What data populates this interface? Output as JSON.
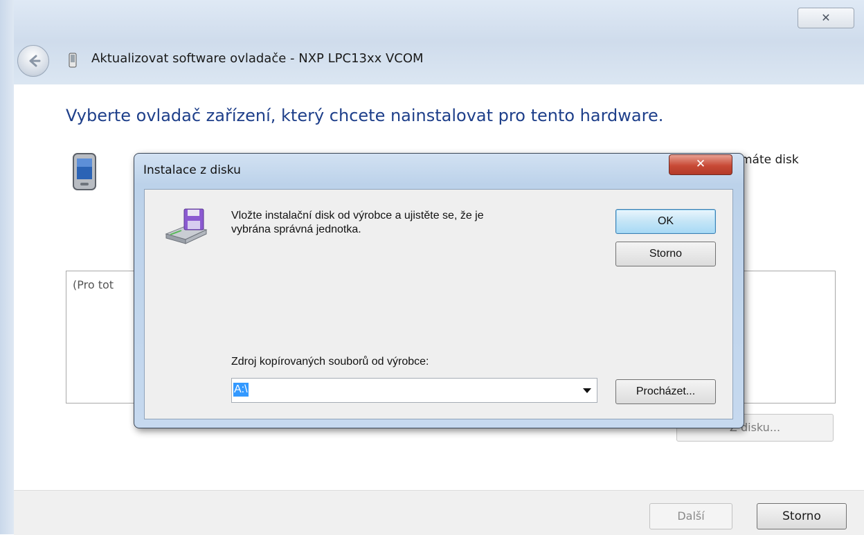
{
  "window": {
    "title": "Aktualizovat software ovladače - NXP LPC13xx VCOM",
    "close_glyph": "✕"
  },
  "wizard": {
    "heading": "Vyberte ovladač zařízení, který chcete nainstalovat pro tento hardware.",
    "description_visible": "máte disk",
    "list_text": "(Pro tot",
    "have_disk_button": "Z disku...",
    "next_button": "Další",
    "cancel_button": "Storno"
  },
  "dialog": {
    "title": "Instalace z disku",
    "close_glyph": "✕",
    "message_line1": "Vložte instalační disk od výrobce a ujistěte se, že je",
    "message_line2": "vybrána správná jednotka.",
    "ok_button": "OK",
    "cancel_button": "Storno",
    "source_label": "Zdroj kopírovaných souborů od výrobce:",
    "source_value": "A:\\",
    "browse_button": "Procházet..."
  },
  "icons": {
    "back": "back-arrow-icon",
    "device": "device-icon",
    "pda": "pda-device-icon",
    "disk": "floppy-drive-icon"
  },
  "colors": {
    "heading": "#1e3f8a",
    "selection": "#3399ff",
    "dialog_close": "#c84a36"
  }
}
